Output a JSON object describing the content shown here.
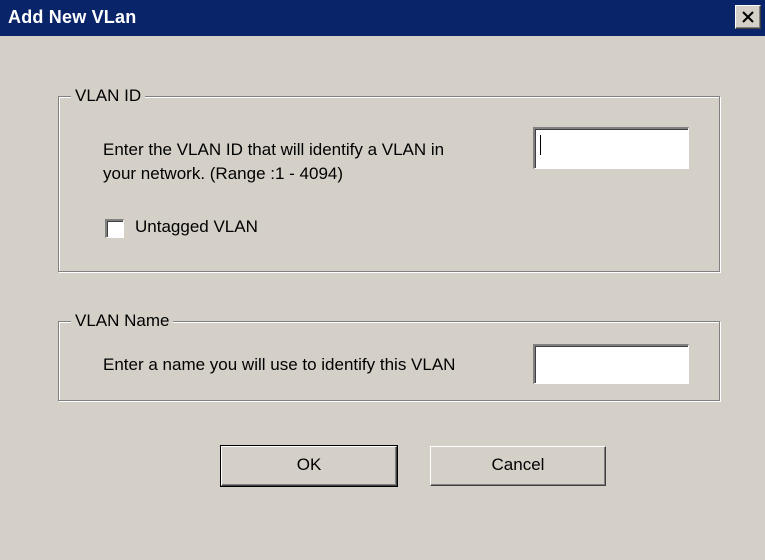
{
  "window": {
    "title": "Add New VLan"
  },
  "vlan_id_group": {
    "legend": "VLAN ID",
    "description_line1": "Enter the VLAN ID that will identify a VLAN in",
    "description_line2": "your network. (Range :1 - 4094)",
    "vlan_id_value": "",
    "untagged_label": "Untagged VLAN",
    "untagged_checked": false
  },
  "vlan_name_group": {
    "legend": "VLAN Name",
    "description": "Enter a name you will use to identify this VLAN",
    "vlan_name_value": ""
  },
  "buttons": {
    "ok_label": "OK",
    "cancel_label": "Cancel"
  },
  "colors": {
    "title_bar": "#0a246a",
    "dialog_face": "#d4d0c8"
  },
  "icons": {
    "close": "close-icon"
  }
}
